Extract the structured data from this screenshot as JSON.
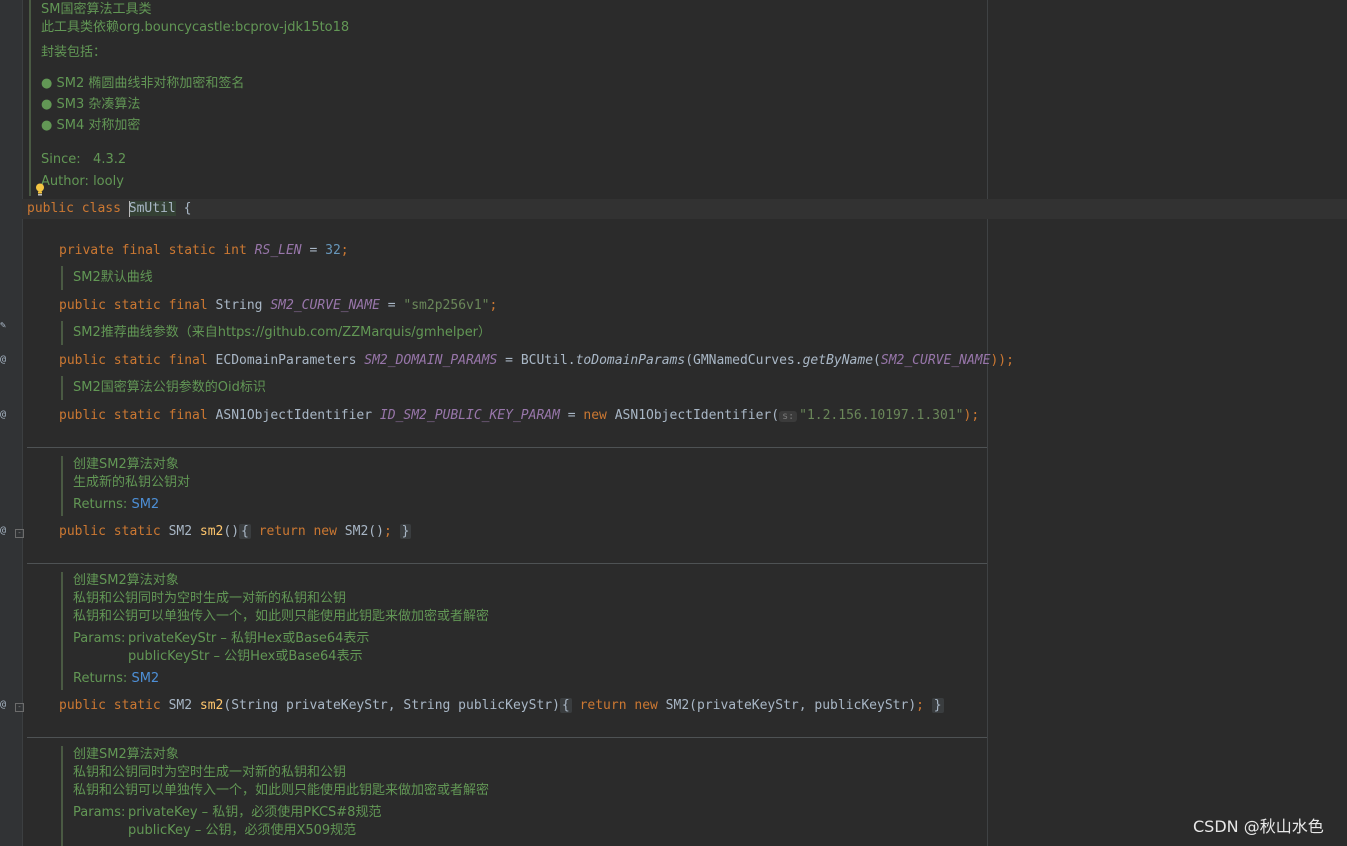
{
  "class_doc": {
    "lines": [
      "SM国密算法工具类",
      "此工具类依赖org.bouncycastle:bcprov-jdk15to18",
      "封装包括："
    ],
    "bullets": [
      "SM2 椭圆曲线非对称加密和签名",
      "SM3 杂凑算法",
      "SM4 对称加密"
    ],
    "since_label": "Since:",
    "since_value": "4.3.2",
    "author_label": "Author:",
    "author_value": "looly"
  },
  "class_decl": {
    "kw_public": "public",
    "kw_class": "class",
    "name": "SmUtil",
    "brace": "{"
  },
  "fields": {
    "rs_len": {
      "mods": "private final static int",
      "name": "RS_LEN",
      "eq": " = ",
      "value": "32",
      "end": ";"
    },
    "curve_doc": "SM2默认曲线",
    "curve": {
      "mods": "public static final",
      "type": " String ",
      "name": "SM2_CURVE_NAME",
      "eq": " = ",
      "value": "\"sm2p256v1\"",
      "end": ";"
    },
    "domain_doc": "SM2推荐曲线参数（来自https://github.com/ZZMarquis/gmhelper）",
    "domain": {
      "mods": "public static final",
      "type": " ECDomainParameters ",
      "name": "SM2_DOMAIN_PARAMS",
      "eq": " = ",
      "cls": "BCUtil.",
      "call": "toDomainParams",
      "arg_open": "(GMNamedCurves.",
      "call2": "getByName",
      "arg2_open": "(",
      "arg": "SM2_CURVE_NAME",
      "end": "));"
    },
    "oid_doc": "SM2国密算法公钥参数的Oid标识",
    "oid": {
      "mods": "public static final",
      "type": " ASN1ObjectIdentifier ",
      "name": "ID_SM2_PUBLIC_KEY_PARAM",
      "eq": " = ",
      "kw_new": "new",
      "ctor": " ASN1ObjectIdentifier(",
      "hint": "s:",
      "value": "\"1.2.156.10197.1.301\"",
      "end": ");"
    }
  },
  "methods": [
    {
      "doc": [
        "创建SM2算法对象",
        "生成新的私钥公钥对"
      ],
      "returns_label": "Returns:",
      "returns_value": "SM2",
      "sig_mods": "public static",
      "sig_type": " SM2 ",
      "sig_name": "sm2",
      "sig_params": "()",
      "body_open": "{",
      "kw_return": "return",
      "kw_new": "new",
      "body": " SM2()",
      "semi": ";",
      "body_close": "}"
    },
    {
      "doc": [
        "创建SM2算法对象",
        "私钥和公钥同时为空时生成一对新的私钥和公钥",
        "私钥和公钥可以单独传入一个，如此则只能使用此钥匙来做加密或者解密"
      ],
      "params_label": "Params:",
      "params": [
        "privateKeyStr – 私钥Hex或Base64表示",
        "publicKeyStr – 公钥Hex或Base64表示"
      ],
      "returns_label": "Returns:",
      "returns_value": "SM2",
      "sig_mods": "public static",
      "sig_type": " SM2 ",
      "sig_name": "sm2",
      "sig_params": "(String privateKeyStr, String publicKeyStr)",
      "body_open": "{",
      "kw_return": "return",
      "kw_new": "new",
      "body": " SM2(privateKeyStr, publicKeyStr)",
      "semi": ";",
      "body_close": "}"
    },
    {
      "doc": [
        "创建SM2算法对象",
        "私钥和公钥同时为空时生成一对新的私钥和公钥",
        "私钥和公钥可以单独传入一个，如此则只能使用此钥匙来做加密或者解密"
      ],
      "params_label": "Params:",
      "params": [
        "privateKey – 私钥，必须使用PKCS#8规范",
        "publicKey – 公钥，必须使用X509规范"
      ]
    }
  ],
  "watermark": "CSDN @秋山水色",
  "colors": {
    "background": "#2b2b2b",
    "keyword": "#cc7832",
    "field": "#9876aa",
    "string": "#6a8759",
    "number": "#6897bb",
    "method": "#ffc66d",
    "doc": "#629755",
    "link": "#4d8fd6"
  }
}
